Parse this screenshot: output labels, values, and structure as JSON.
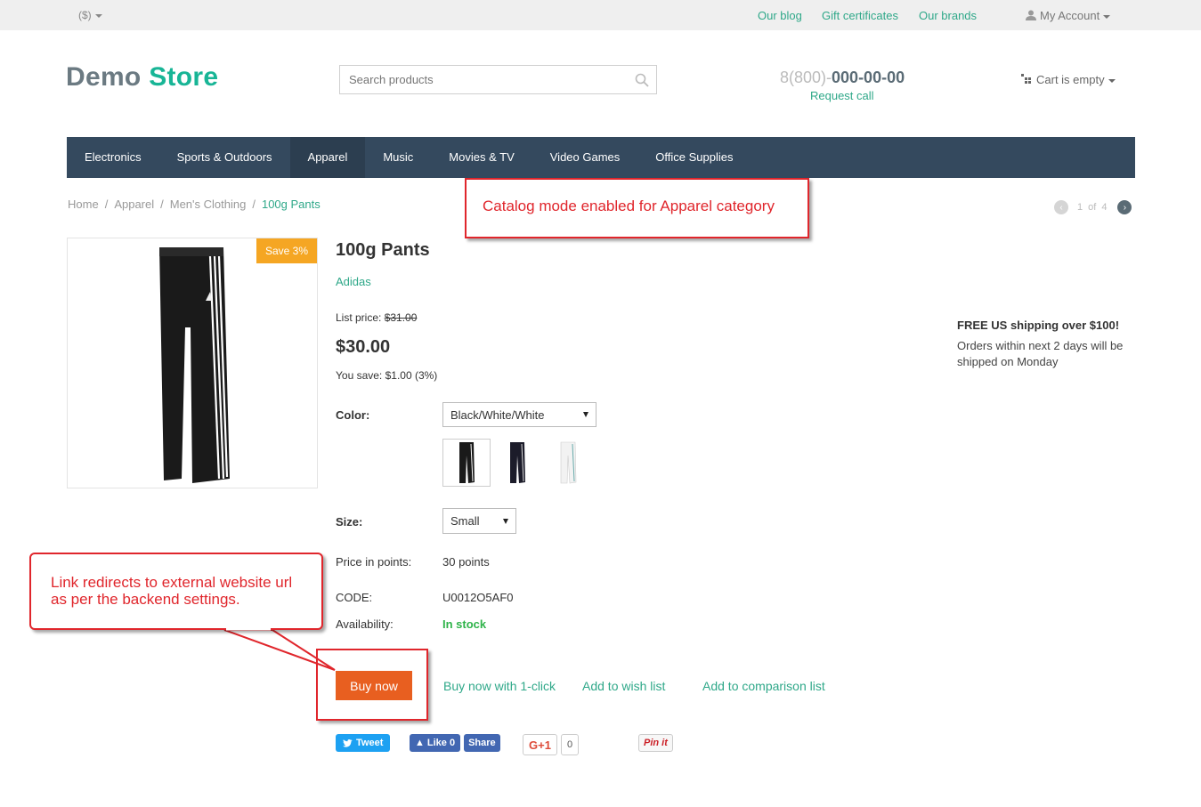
{
  "topbar": {
    "currency": "($)",
    "links": [
      "Our blog",
      "Gift certificates",
      "Our brands"
    ],
    "account": "My Account"
  },
  "header": {
    "logo_part1": "Demo",
    "logo_part2": "Store",
    "search_placeholder": "Search products",
    "phone_prefix": "8(800)-",
    "phone_number": "000-00-00",
    "request_call": "Request call",
    "cart": "Cart is empty"
  },
  "nav": [
    "Electronics",
    "Sports & Outdoors",
    "Apparel",
    "Music",
    "Movies & TV",
    "Video Games",
    "Office Supplies"
  ],
  "breadcrumb": {
    "home": "Home",
    "category": "Apparel",
    "subcategory": "Men's Clothing",
    "current": "100g Pants"
  },
  "pager": {
    "current": "1",
    "of": "of",
    "total": "4"
  },
  "annotations": {
    "catalog_mode": "Catalog mode enabled for Apparel category",
    "link_redirect": "Link redirects to external website url as per the backend settings."
  },
  "product": {
    "badge": "Save 3%",
    "title": "100g Pants",
    "brand": "Adidas",
    "list_price_label": "List price:",
    "list_price": "$31.00",
    "price": "$30.00",
    "you_save": "You save: $1.00 (3%)",
    "color_label": "Color:",
    "color_value": "Black/White/White",
    "size_label": "Size:",
    "size_value": "Small",
    "points_label": "Price in points:",
    "points_value": "30 points",
    "code_label": "CODE:",
    "code_value": "U0012O5AF0",
    "availability_label": "Availability:",
    "availability_value": "In stock"
  },
  "actions": {
    "buy_now": "Buy now",
    "one_click": "Buy now with 1-click",
    "wishlist": "Add to wish list",
    "compare": "Add to comparison list"
  },
  "shipping": {
    "heading": "FREE US shipping over $100!",
    "text": "Orders within next 2 days will be shipped on Monday"
  },
  "social": {
    "tweet": "Tweet",
    "like": "Like 0",
    "share": "Share",
    "gplus": "G+1",
    "gplus_count": "0",
    "pinit": "Pin it"
  },
  "colors": {
    "accent": "#2fa889",
    "nav_bg": "#34495e",
    "buy_button": "#e85f20",
    "badge": "#f5a623",
    "annotation": "#e0262c"
  }
}
